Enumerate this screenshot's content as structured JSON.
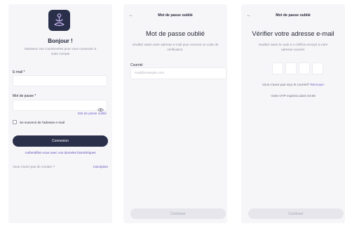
{
  "login": {
    "title": "Bonjour !",
    "subtitle": "Saisissez vos coordonnées pour vous connecter à votre compte",
    "email_label": "E-mail *",
    "password_label": "Mot de passe *",
    "forgot_link": "Mot de passe oublié",
    "remember_label": "Se souvenir de l'adresse e-mail",
    "login_button": "Connexion",
    "biometric_link": "Authentifiez-vous avec vos données biométriques",
    "no_account": "Vous n'avez pas de compte ?",
    "signup_link": "Inscription"
  },
  "forgot": {
    "back_icon": "←",
    "header_title": "Mot de passe oublié",
    "title": "Mot de passe oublié",
    "description": "Veuillez saisir votre adresse e-mail pour recevoir un code de vérification.",
    "email_label": "Courriel",
    "email_placeholder": "mail@example.com",
    "continue_button": "Continuer"
  },
  "verify": {
    "back_icon": "←",
    "header_title": "Mot de passe oublié",
    "title": "Vérifier votre adresse e-mail",
    "description": "Veuillez saisir le code à 4 chiffres envoyé à votre adresse courriel.",
    "resend_question": "Vous n'avez pas reçu le courriel?",
    "resend_link": "Renvoyer",
    "expiry_text": "Votre OTP expirera dans 04:58",
    "continue_button": "Continuer"
  },
  "colors": {
    "primary_dark": "#2a2f4a",
    "accent_purple": "#6c5ccc",
    "screen_bg": "#f6f6f9"
  }
}
